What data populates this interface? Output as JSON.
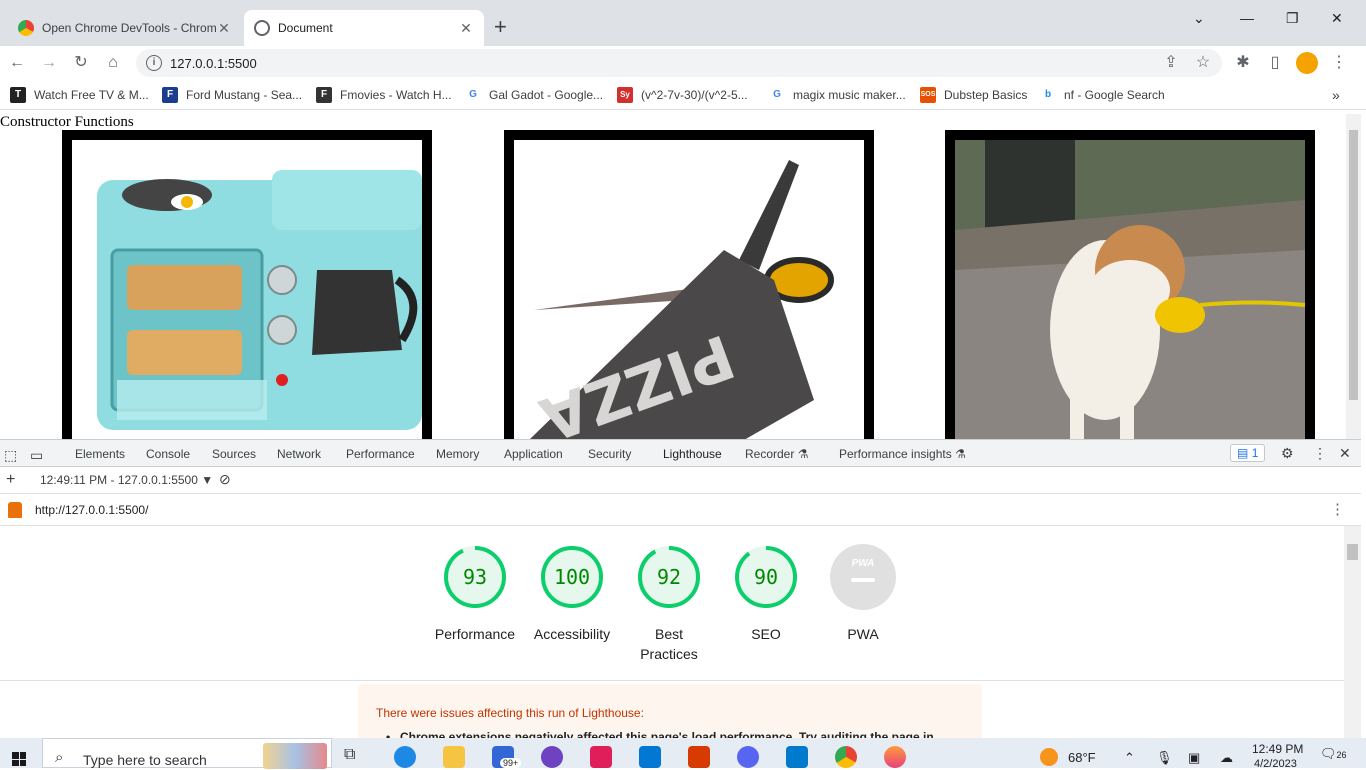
{
  "tabs": [
    {
      "title": "Open Chrome DevTools - Chrome",
      "active": false
    },
    {
      "title": "Document",
      "active": true
    }
  ],
  "window_controls": {
    "tablist": "⌄",
    "minimize": "—",
    "maximize": "❐",
    "close": "✕"
  },
  "toolbar": {
    "url": "127.0.0.1:5500"
  },
  "bookmarks": [
    {
      "label": "Watch Free TV & M...",
      "icon": "T",
      "color": "#222222"
    },
    {
      "label": "Ford Mustang - Sea...",
      "icon": "F",
      "color": "#1a3d8f"
    },
    {
      "label": "Fmovies - Watch H...",
      "icon": "F",
      "color": "#333333"
    },
    {
      "label": "Gal Gadot - Google...",
      "icon": "G",
      "color": "#4285f4"
    },
    {
      "label": "(v^2-7v-30)/(v^2-5...",
      "icon": "Sy",
      "color": "#d32f2f"
    },
    {
      "label": "magix music maker...",
      "icon": "G",
      "color": "#4285f4"
    },
    {
      "label": "Dubstep Basics",
      "icon": "SOS",
      "color": "#e65100"
    },
    {
      "label": "nf - Google Search",
      "icon": "b",
      "color": "#1e88e5"
    }
  ],
  "page": {
    "title": "Constructor Functions"
  },
  "devtools": {
    "tabs": [
      "Elements",
      "Console",
      "Sources",
      "Network",
      "Performance",
      "Memory",
      "Application",
      "Security",
      "Lighthouse",
      "Recorder",
      "Performance insights"
    ],
    "active_tab": "Lighthouse",
    "issues_count": "1",
    "report_selector": "12:49:11 PM - 127.0.0.1:5500",
    "report_url": "http://127.0.0.1:5500/"
  },
  "lighthouse": {
    "gauges": [
      {
        "score": "93",
        "label": "Performance",
        "value": 0.93
      },
      {
        "score": "100",
        "label": "Accessibility",
        "value": 1.0
      },
      {
        "score": "92",
        "label": "Best Practices",
        "value": 0.92
      },
      {
        "score": "90",
        "label": "SEO",
        "value": 0.9
      }
    ],
    "pwa": {
      "label": "PWA",
      "badge": "PWA"
    },
    "warning_title": "There were issues affecting this run of Lighthouse:",
    "warning_item": "Chrome extensions negatively affected this page's load performance. Try auditing the page in"
  },
  "taskbar": {
    "search_placeholder": "Type here to search",
    "weather": "68°F",
    "time": "12:49 PM",
    "date": "4/2/2023",
    "mail_badge": "99+",
    "notif_badge": "26"
  },
  "colors": {
    "score_green": "#0cce6b",
    "accent_blue": "#1a73e8"
  }
}
